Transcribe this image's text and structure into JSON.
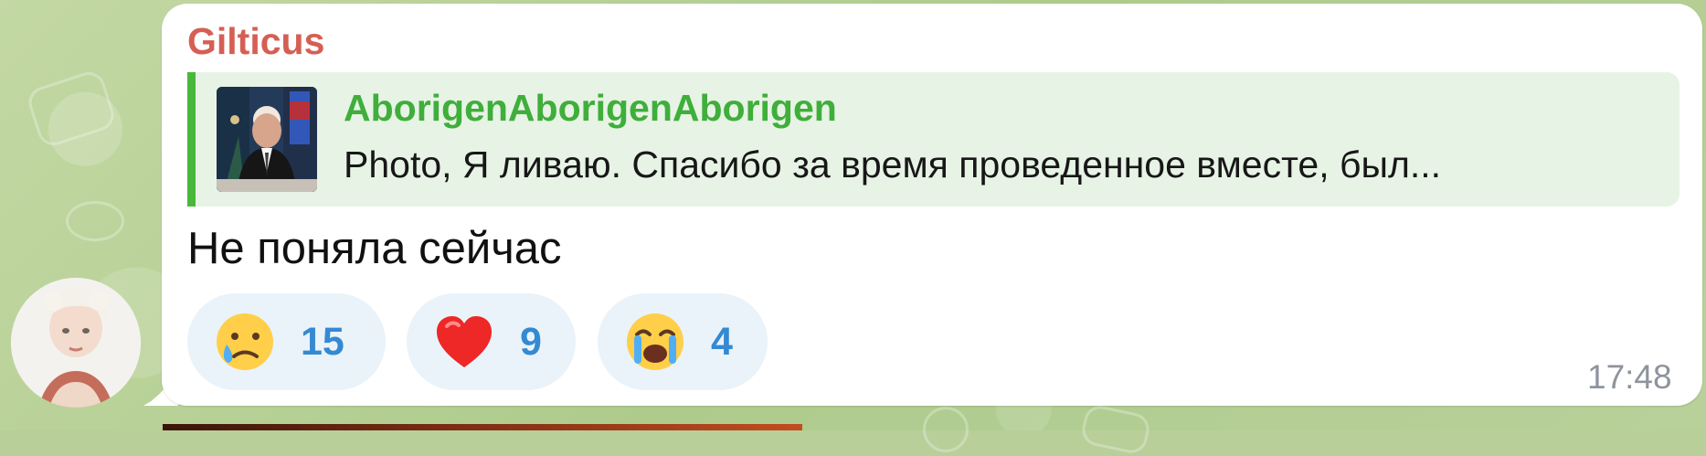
{
  "message": {
    "sender": "Gilticus",
    "reply": {
      "author": "AborigenAborigenAborigen",
      "preview": "Photo, Я ливаю. Спасибо за время проведенное вместе, был..."
    },
    "text": "Не поняла сейчас",
    "reactions": [
      {
        "icon": "crying-face-icon",
        "count": "15"
      },
      {
        "icon": "heart-icon",
        "count": "9"
      },
      {
        "icon": "loudly-crying-face-icon",
        "count": "4"
      }
    ],
    "time": "17:48"
  },
  "colors": {
    "sender": "#d55f53",
    "reply_accent": "#48b83c",
    "reaction_count": "#3489d3",
    "chat_background": "#b9cf9a"
  }
}
